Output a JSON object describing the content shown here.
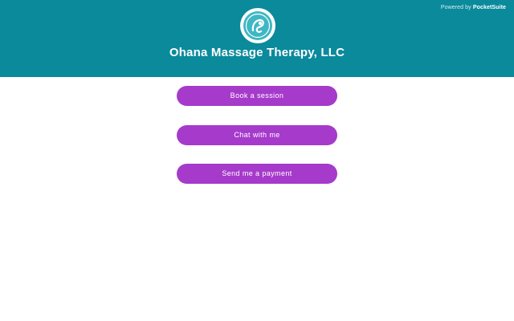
{
  "header": {
    "powered_prefix": "Powered by ",
    "powered_brand": "PocketSuite",
    "business_name": "Ohana Massage Therapy, LLC",
    "logo_icon": "massage-logo-icon",
    "background_color": "#0b8a9c"
  },
  "actions": [
    {
      "label": "Book a session"
    },
    {
      "label": "Chat with me"
    },
    {
      "label": "Send me a payment"
    }
  ],
  "colors": {
    "button": "#a63acb",
    "logo_accent": "#3fb7c4"
  }
}
